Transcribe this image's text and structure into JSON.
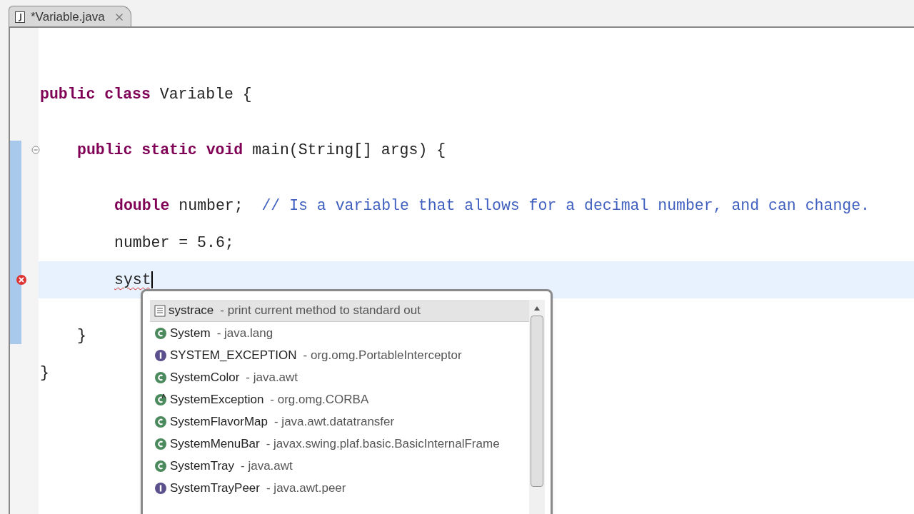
{
  "editor_tab": {
    "title": "*Variable.java",
    "selected": true
  },
  "code_lines": [
    {
      "kind": "blank"
    },
    {
      "kind": "blank"
    },
    {
      "kind": "code",
      "tokens": [
        {
          "kind": "keyword",
          "text": "public "
        },
        {
          "kind": "keyword",
          "text": "class "
        },
        {
          "kind": "plain",
          "text": "Variable {"
        }
      ],
      "children": [
        {
          "kind": "blank"
        },
        {
          "kind": "code",
          "fold": true,
          "tokens": [
            {
              "kind": "keyword",
              "text": "public "
            },
            {
              "kind": "keyword",
              "text": "static "
            },
            {
              "kind": "keyword",
              "text": "void "
            },
            {
              "kind": "plain",
              "text": "main(String[] args) {"
            }
          ],
          "children": [
            {
              "kind": "blank"
            },
            {
              "kind": "code",
              "tokens": [
                {
                  "kind": "keyword",
                  "text": "double "
                },
                {
                  "kind": "plain",
                  "text": "number;  "
                },
                {
                  "kind": "comment",
                  "text": "// Is a variable that allows for a decimal number, and can change."
                }
              ]
            },
            {
              "kind": "code",
              "tokens": [
                {
                  "kind": "plain",
                  "text": "number = 5.6;"
                }
              ]
            },
            {
              "kind": "code",
              "current": true,
              "error": true,
              "tokens": [
                {
                  "kind": "error",
                  "text": "syst"
                }
              ]
            },
            {
              "kind": "blank"
            }
          ]
        },
        {
          "kind": "code",
          "tokens": [
            {
              "kind": "plain",
              "text": "}"
            }
          ]
        }
      ]
    },
    {
      "kind": "code",
      "tokens": [
        {
          "kind": "plain",
          "text": "}"
        }
      ]
    }
  ],
  "completion_popup": {
    "items": [
      {
        "kind": "template",
        "name": "systrace",
        "detail": "- print current method to standard out",
        "selected": true
      },
      {
        "kind": "class",
        "name": "System",
        "detail": "- java.lang",
        "selected": false
      },
      {
        "kind": "interface",
        "name": "SYSTEM_EXCEPTION",
        "detail": "- org.omg.PortableInterceptor",
        "selected": false
      },
      {
        "kind": "class",
        "name": "SystemColor",
        "detail": "- java.awt",
        "selected": false
      },
      {
        "kind": "abstract_class",
        "name": "SystemException",
        "detail": "- org.omg.CORBA",
        "selected": false
      },
      {
        "kind": "class",
        "name": "SystemFlavorMap",
        "detail": "- java.awt.datatransfer",
        "selected": false
      },
      {
        "kind": "class",
        "name": "SystemMenuBar",
        "detail": "- javax.swing.plaf.basic.BasicInternalFrame",
        "selected": false
      },
      {
        "kind": "class",
        "name": "SystemTray",
        "detail": "- java.awt",
        "selected": false
      },
      {
        "kind": "interface",
        "name": "SystemTrayPeer",
        "detail": "- java.awt.peer",
        "selected": false
      }
    ]
  }
}
